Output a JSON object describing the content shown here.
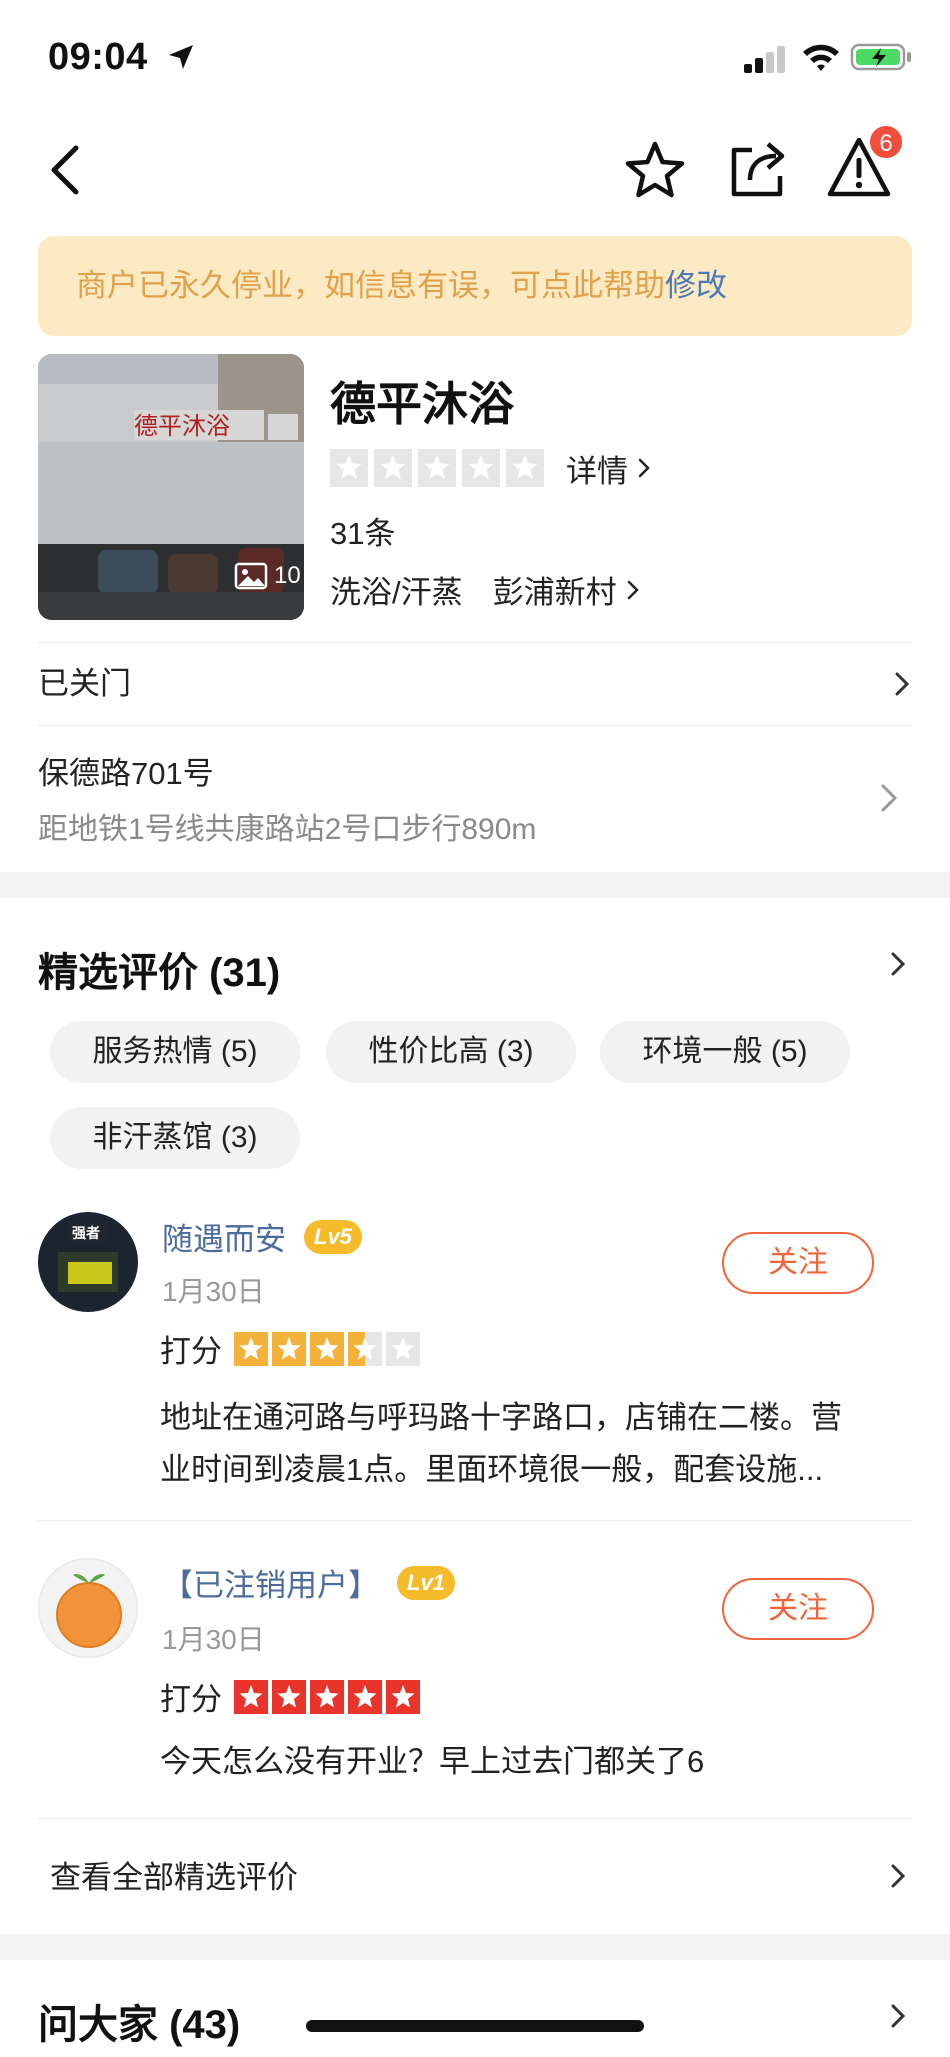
{
  "status_bar": {
    "time": "09:04"
  },
  "nav": {
    "badge_count": "6"
  },
  "notice": {
    "text": "商户已永久停业，如信息有误，可点此帮助",
    "link": "修改"
  },
  "shop": {
    "name": "德平沐浴",
    "photo_count": "10",
    "detail_label": "详情",
    "review_count": "31条",
    "category": "洗浴/汗蒸",
    "area": "彭浦新村"
  },
  "status_row": {
    "label": "已关门"
  },
  "address": {
    "street": "保德路701号",
    "transit": "距地铁1号线共康路站2号口步行890m"
  },
  "reviews_section": {
    "title": "精选评价 (31)",
    "tags": [
      "服务热情 (5)",
      "性价比高 (3)",
      "环境一般 (5)",
      "非汗蒸馆 (3)"
    ],
    "see_all": "查看全部精选评价"
  },
  "reviews": [
    {
      "user": "随遇而安",
      "level": "Lv5",
      "date": "1月30日",
      "follow": "关注",
      "score_label": "打分",
      "rating": 3.5,
      "text_line1": "地址在通河路与呼玛路十字路口，店铺在二楼。营",
      "text_line2": "业时间到凌晨1点。里面环境很一般，配套设施..."
    },
    {
      "user": "【已注销用户】",
      "level": "Lv1",
      "date": "1月30日",
      "follow": "关注",
      "score_label": "打分",
      "rating": 5,
      "text_line1": "今天怎么没有开业？早上过去门都关了6"
    }
  ],
  "qa_section": {
    "title": "问大家 (43)"
  },
  "colors": {
    "accent": "#f0643a",
    "notice_bg": "#fbeac3",
    "link_blue": "#4b79b6",
    "star_gold": "#f5b23b",
    "star_red": "#e8342a"
  }
}
